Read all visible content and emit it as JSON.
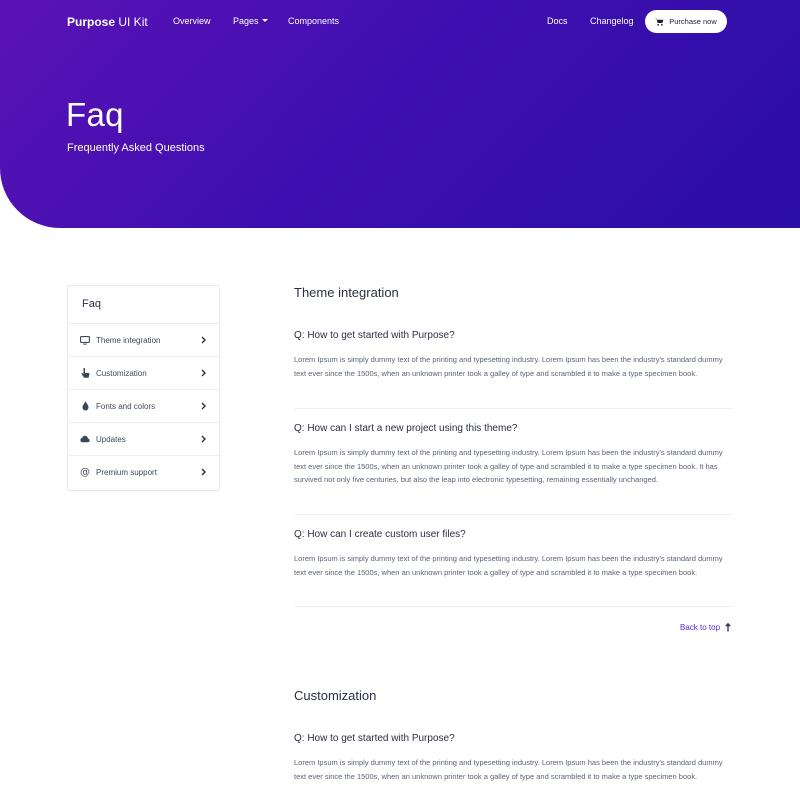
{
  "nav": {
    "brand_bold": "Purpose",
    "brand_rest": " UI Kit",
    "overview": "Overview",
    "pages": "Pages",
    "components": "Components",
    "docs": "Docs",
    "changelog": "Changelog",
    "purchase": "Purchase now"
  },
  "hero": {
    "title": "Faq",
    "subtitle": "Frequently Asked Questions"
  },
  "sidebar": {
    "heading": "Faq",
    "items": [
      {
        "label": "Theme integration",
        "icon": "monitor-icon"
      },
      {
        "label": "Customization",
        "icon": "pointer-icon"
      },
      {
        "label": "Fonts and colors",
        "icon": "droplet-icon"
      },
      {
        "label": "Updates",
        "icon": "cloud-icon"
      },
      {
        "label": "Premium support",
        "icon": "at-icon"
      }
    ]
  },
  "sections": [
    {
      "title": "Theme integration",
      "questions": [
        {
          "q": "Q: How to get started with Purpose?",
          "a": "Lorem Ipsum is simply dummy text of the printing and typesetting industry. Lorem Ipsum has been the industry's standard dummy text ever since the 1500s, when an unknown printer took a galley of type and scrambled it to make a type specimen book."
        },
        {
          "q": "Q: How can I start a new project using this theme?",
          "a": "Lorem Ipsum is simply dummy text of the printing and typesetting industry. Lorem Ipsum has been the industry's standard dummy text ever since the 1500s, when an unknown printer took a galley of type and scrambled it to make a type specimen book. It has survived not only five centuries, but also the leap into electronic typesetting, remaining essentially unchanged."
        },
        {
          "q": "Q: How can I create custom user files?",
          "a": "Lorem Ipsum is simply dummy text of the printing and typesetting industry. Lorem Ipsum has been the industry's standard dummy text ever since the 1500s, when an unknown printer took a galley of type and scrambled it to make a type specimen book."
        }
      ]
    },
    {
      "title": "Customization",
      "questions": [
        {
          "q": "Q: How to get started with Purpose?",
          "a": "Lorem Ipsum is simply dummy text of the printing and typesetting industry. Lorem Ipsum has been the industry's standard dummy text ever since the 1500s, when an unknown printer took a galley of type and scrambled it to make a type specimen book."
        }
      ]
    }
  ],
  "back_to_top": "Back to top",
  "colors": {
    "hero_start": "#5b12b6",
    "hero_end": "#2a0ea6",
    "accent": "#5b2ad0"
  }
}
